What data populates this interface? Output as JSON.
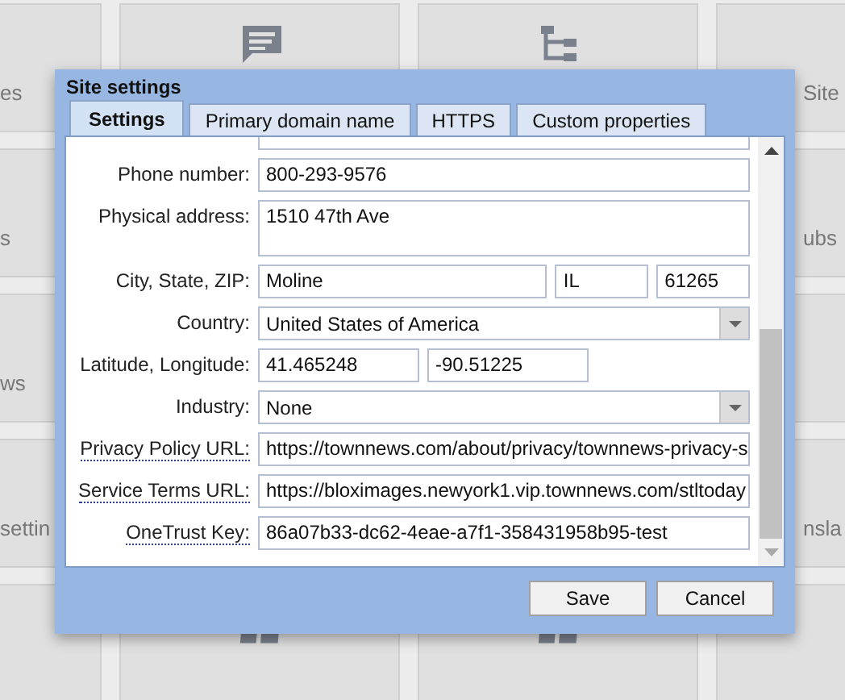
{
  "background": {
    "left_labels": [
      "es",
      "s",
      "ws",
      "settin"
    ],
    "right_labels": [
      "Site",
      "ubs",
      "nsla"
    ]
  },
  "dialog": {
    "title": "Site settings",
    "tabs": [
      {
        "label": "Settings",
        "selected": true
      },
      {
        "label": "Primary domain name",
        "selected": false
      },
      {
        "label": "HTTPS",
        "selected": false
      },
      {
        "label": "Custom properties",
        "selected": false
      }
    ],
    "fields": [
      {
        "kind": "cut"
      },
      {
        "kind": "text",
        "label": "Phone number:",
        "values": [
          "800-293-9576"
        ],
        "help_link": false
      },
      {
        "kind": "textarea",
        "label": "Physical address:",
        "values": [
          "1510 47th Ave"
        ],
        "help_link": false
      },
      {
        "kind": "triple",
        "label": "City, State, ZIP:",
        "values": [
          "Moline",
          "IL",
          "61265"
        ],
        "help_link": false
      },
      {
        "kind": "select",
        "label": "Country:",
        "values": [
          "United States of America"
        ],
        "help_link": false
      },
      {
        "kind": "pair",
        "label": "Latitude, Longitude:",
        "values": [
          "41.465248",
          "-90.51225"
        ],
        "help_link": false
      },
      {
        "kind": "select",
        "label": "Industry:",
        "values": [
          "None"
        ],
        "help_link": false
      },
      {
        "kind": "text",
        "label": "Privacy Policy URL:",
        "values": [
          "https://townnews.com/about/privacy/townnews-privacy-s"
        ],
        "help_link": true
      },
      {
        "kind": "text",
        "label": "Service Terms URL:",
        "values": [
          "https://bloximages.newyork1.vip.townnews.com/stltoday"
        ],
        "help_link": true
      },
      {
        "kind": "text",
        "label": "OneTrust Key:",
        "values": [
          "86a07b33-dc62-4eae-a7f1-358431958b95-test"
        ],
        "help_link": true
      }
    ],
    "buttons": [
      "Save",
      "Cancel"
    ]
  }
}
